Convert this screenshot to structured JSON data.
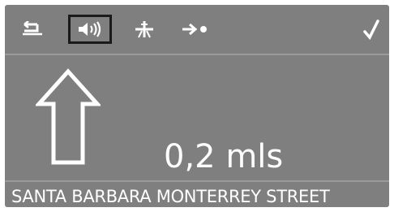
{
  "toolbar": {
    "icons": [
      "back-icon",
      "speaker-volume-icon",
      "route-icon",
      "destination-icon",
      "checkmark-icon"
    ],
    "selected": "speaker-volume-icon"
  },
  "guidance": {
    "direction_icon": "straight-ahead-arrow-icon",
    "distance": "0,2 mls"
  },
  "status": {
    "street": "SANTA BARBARA MONTERREY STREET"
  },
  "colors": {
    "screen_background": "#7f7f7f",
    "foreground": "#ffffff",
    "selection_border": "#1a1a1a"
  }
}
